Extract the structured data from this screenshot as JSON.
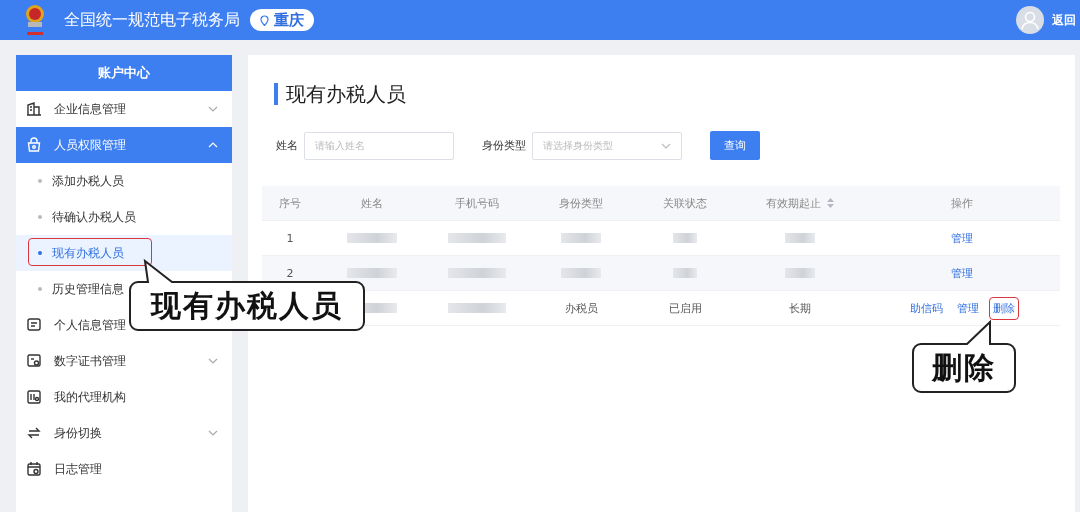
{
  "header": {
    "title": "全国统一规范电子税务局",
    "location": "重庆",
    "back": "返回"
  },
  "sidebar": {
    "title": "账户中心",
    "items": [
      {
        "label": "企业信息管理",
        "expanded": false,
        "selected": false
      },
      {
        "label": "人员权限管理",
        "expanded": true,
        "selected": true,
        "children": [
          {
            "label": "添加办税人员",
            "selected": false,
            "highlighted": false
          },
          {
            "label": "待确认办税人员",
            "selected": false,
            "highlighted": false
          },
          {
            "label": "现有办税人员",
            "selected": true,
            "highlighted": true
          },
          {
            "label": "历史管理信息",
            "selected": false,
            "highlighted": false
          }
        ]
      },
      {
        "label": "个人信息管理",
        "selected": false
      },
      {
        "label": "数字证书管理",
        "expanded": false,
        "selected": false
      },
      {
        "label": "我的代理机构",
        "selected": false
      },
      {
        "label": "身份切换",
        "expanded": false,
        "selected": false
      },
      {
        "label": "日志管理",
        "selected": false
      }
    ]
  },
  "page": {
    "title": "现有办税人员",
    "filters": [
      {
        "label": "姓名",
        "kind": "input",
        "placeholder": "请输入姓名"
      },
      {
        "label": "身份类型",
        "kind": "select",
        "placeholder": "请选择身份类型"
      }
    ],
    "search_button": "查询",
    "table": {
      "columns": [
        {
          "label": "序号",
          "sortable": false
        },
        {
          "label": "姓名",
          "sortable": false
        },
        {
          "label": "手机号码",
          "sortable": false
        },
        {
          "label": "身份类型",
          "sortable": false
        },
        {
          "label": "关联状态",
          "sortable": false
        },
        {
          "label": "有效期起止",
          "sortable": true
        },
        {
          "label": "操作",
          "sortable": false
        }
      ],
      "rows": [
        {
          "cells": [
            {
              "kind": "text",
              "text": "1"
            },
            {
              "kind": "redacted"
            },
            {
              "kind": "redacted"
            },
            {
              "kind": "redacted"
            },
            {
              "kind": "redacted"
            },
            {
              "kind": "redacted"
            }
          ],
          "actions": [
            {
              "label": "管理",
              "highlighted": false
            }
          ]
        },
        {
          "cells": [
            {
              "kind": "text",
              "text": "2"
            },
            {
              "kind": "redacted"
            },
            {
              "kind": "redacted"
            },
            {
              "kind": "redacted"
            },
            {
              "kind": "redacted"
            },
            {
              "kind": "redacted"
            }
          ],
          "actions": [
            {
              "label": "管理",
              "highlighted": false
            }
          ]
        },
        {
          "cells": [
            {
              "kind": "covered"
            },
            {
              "kind": "redacted"
            },
            {
              "kind": "redacted"
            },
            {
              "kind": "text",
              "text": "办税员"
            },
            {
              "kind": "text",
              "text": "已启用"
            },
            {
              "kind": "text",
              "text": "长期"
            }
          ],
          "actions": [
            {
              "label": "助信码",
              "highlighted": false
            },
            {
              "label": "管理",
              "highlighted": false
            },
            {
              "label": "删除",
              "highlighted": true
            }
          ]
        }
      ]
    }
  },
  "callouts": [
    {
      "text": "现有办税人员"
    },
    {
      "text": "删除"
    }
  ]
}
